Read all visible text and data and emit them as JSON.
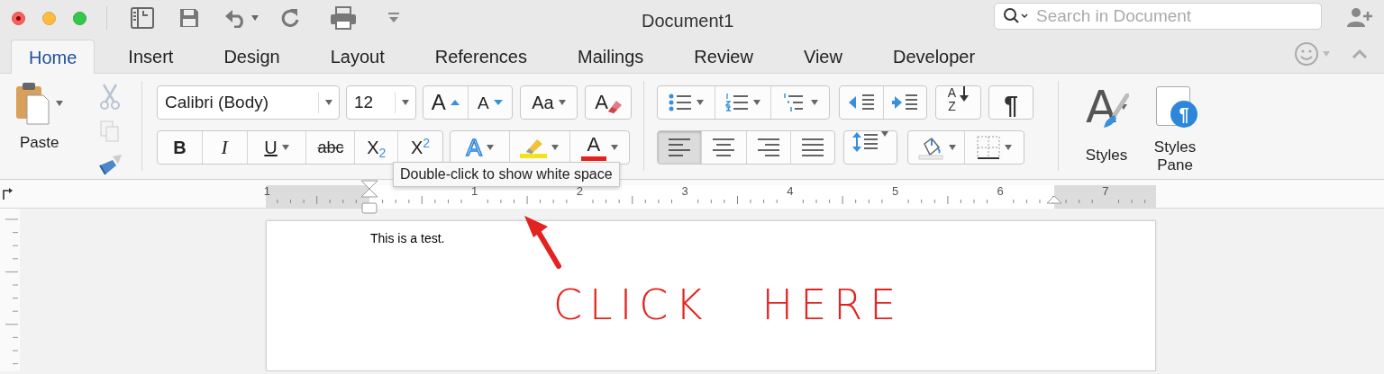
{
  "window": {
    "title": "Document1"
  },
  "search": {
    "placeholder": "Search in Document"
  },
  "tabs": [
    {
      "label": "Home",
      "selected": true
    },
    {
      "label": "Insert",
      "selected": false
    },
    {
      "label": "Design",
      "selected": false
    },
    {
      "label": "Layout",
      "selected": false
    },
    {
      "label": "References",
      "selected": false
    },
    {
      "label": "Mailings",
      "selected": false
    },
    {
      "label": "Review",
      "selected": false
    },
    {
      "label": "View",
      "selected": false
    },
    {
      "label": "Developer",
      "selected": false
    }
  ],
  "paste": {
    "label": "Paste"
  },
  "font": {
    "name": "Calibri (Body)",
    "size": "12"
  },
  "font_buttons": [
    {
      "kind": "grow",
      "label": "A"
    },
    {
      "kind": "shrink",
      "label": "A"
    },
    {
      "kind": "case",
      "label": "Aa"
    },
    {
      "kind": "clear",
      "label": "A"
    }
  ],
  "format_buttons": [
    {
      "kind": "bold",
      "label": "B"
    },
    {
      "kind": "italic",
      "label": "I"
    },
    {
      "kind": "underline",
      "label": "U"
    },
    {
      "kind": "strike",
      "label": "abc"
    },
    {
      "kind": "subscript",
      "label": "X$_{2}$"
    },
    {
      "kind": "superscript",
      "label": "X$^{2}$"
    }
  ],
  "color_buttons": [
    {
      "kind": "effects",
      "label": "A"
    },
    {
      "kind": "highlight",
      "color": "#f4e21c"
    },
    {
      "kind": "font_color",
      "label": "A",
      "color": "#e3231f"
    }
  ],
  "alignment": [
    {
      "kind": "left",
      "selected": true
    },
    {
      "kind": "center",
      "selected": false
    },
    {
      "kind": "right",
      "selected": false
    },
    {
      "kind": "justify",
      "selected": false
    }
  ],
  "sort": {
    "top": "A",
    "bottom": "Z"
  },
  "show_marks": {
    "label": "¶"
  },
  "styles": {
    "glyph": "A",
    "label": "Styles"
  },
  "styles_pane": {
    "glyph": "¶",
    "label": "Styles Pane"
  },
  "ruler": {
    "numbers": [
      "1",
      "1",
      "2",
      "3",
      "4",
      "5",
      "6",
      "7"
    ]
  },
  "tooltip": {
    "text": "Double-click to show white space"
  },
  "document": {
    "text": "This is a test."
  },
  "annotation": {
    "words": [
      "CLICK",
      "HERE"
    ]
  }
}
